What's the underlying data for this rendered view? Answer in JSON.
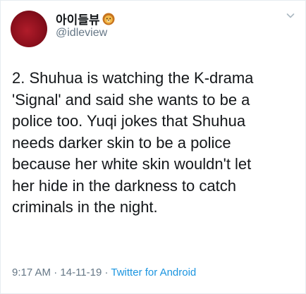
{
  "tweet": {
    "display_name": "아이들뷰",
    "handle": "@idleview",
    "text": "2. Shuhua is watching the K-drama\n'Signal' and said she wants to be a\npolice too. Yuqi jokes that Shuhua\nneeds darker skin to be a police\nbecause her white skin wouldn't let\nher hide in the darkness to catch\ncriminals in the night.",
    "time": "9:17 AM",
    "separator_1": " · ",
    "date": "14-11-19",
    "separator_2": " · ",
    "source": "Twitter for Android"
  },
  "icons": {
    "name_emoji": "lion-face-icon",
    "menu": "chevron-down-icon"
  },
  "colors": {
    "text": "#14171a",
    "secondary": "#657786",
    "link": "#1b95e0",
    "border": "#e6ecf0",
    "avatar": "#8a0f1c"
  }
}
